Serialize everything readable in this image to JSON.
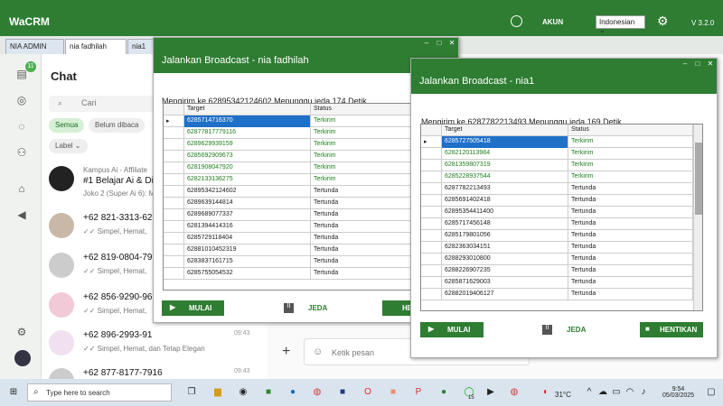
{
  "app": {
    "title": "WaCRM",
    "account_label": "AKUN",
    "language": "Indonesian",
    "version": "V 3.2.0"
  },
  "tabs": [
    "NIA ADMIN",
    "nia fadhilah",
    "nia1"
  ],
  "sidebar": {
    "badge": "11"
  },
  "chat": {
    "title": "Chat",
    "search_placeholder": "Cari",
    "filters": [
      "Semua",
      "Belum dibaca"
    ],
    "label_filter": "Label",
    "rows": [
      {
        "sub": "Kampus Ai - Affiliate",
        "name": "#1 Belajar Ai & Di",
        "msg": "Joko 2 (Super Ai 6): M",
        "time": ""
      },
      {
        "sub": "",
        "name": "+62 821-3313-62",
        "msg": "✓✓ Simpel, Hemat,",
        "time": ""
      },
      {
        "sub": "",
        "name": "+62 819-0804-79",
        "msg": "✓✓ Simpel, Hemat,",
        "time": ""
      },
      {
        "sub": "",
        "name": "+62 856-9290-96",
        "msg": "✓✓ Simpel, Hemat,",
        "time": ""
      },
      {
        "sub": "",
        "name": "+62 896-2993-91",
        "msg": "✓✓ Simpel, Hemat, dan Tetap Elegan",
        "time": "09:43"
      },
      {
        "sub": "",
        "name": "+62 877-8177-7916",
        "msg": "",
        "time": "09:43"
      }
    ]
  },
  "compose": {
    "placeholder": "Ketik pesan"
  },
  "broadcast_left": {
    "title": "Jalankan Broadcast - nia fadhilah",
    "info": "Mengirim ke 62895342124602  Menunggu jeda 174 Detik",
    "col_target": "Target",
    "col_status": "Status",
    "rows": [
      [
        "6285714716370",
        "Terkirim"
      ],
      [
        "62877817779116",
        "Terkirim"
      ],
      [
        "6289629939159",
        "Terkirim"
      ],
      [
        "6285692909673",
        "Terkirim"
      ],
      [
        "6281908047920",
        "Terkirim"
      ],
      [
        "6282133136275",
        "Terkirim"
      ],
      [
        "62895342124602",
        "Tertunda"
      ],
      [
        "6289639144814",
        "Tertunda"
      ],
      [
        "6289689077337",
        "Tertunda"
      ],
      [
        "6281394414316",
        "Tertunda"
      ],
      [
        "6285729118404",
        "Tertunda"
      ],
      [
        "62881010452319",
        "Tertunda"
      ],
      [
        "6283837161715",
        "Tertunda"
      ],
      [
        "6285755054532",
        "Tertunda"
      ]
    ],
    "btn_start": "MULAI",
    "btn_pause": "JEDA",
    "btn_stop": "HE"
  },
  "broadcast_right": {
    "title": "Jalankan Broadcast - nia1",
    "info": "Mengirim ke 6287782213493  Menunggu jeda 169 Detik",
    "col_target": "Target",
    "col_status": "Status",
    "rows": [
      [
        "6285727505418",
        "Terkirim"
      ],
      [
        "6282120113984",
        "Terkirim"
      ],
      [
        "6281359807319",
        "Terkirim"
      ],
      [
        "6285228937544",
        "Terkirim"
      ],
      [
        "6287782213493",
        "Tertunda"
      ],
      [
        "6285691402418",
        "Tertunda"
      ],
      [
        "62895354411400",
        "Tertunda"
      ],
      [
        "6285717456148",
        "Tertunda"
      ],
      [
        "6285179801056",
        "Tertunda"
      ],
      [
        "6282363034151",
        "Tertunda"
      ],
      [
        "6288293010800",
        "Tertunda"
      ],
      [
        "6288226907235",
        "Tertunda"
      ],
      [
        "6285871629003",
        "Tertunda"
      ],
      [
        "62882019406127",
        "Tertunda"
      ]
    ],
    "btn_start": "MULAI",
    "btn_pause": "JEDA",
    "btn_stop": "HENTIKAN"
  },
  "taskbar": {
    "search_placeholder": "Type here to search",
    "temp": "31°C",
    "time": "9:54",
    "date": "05/03/2025",
    "notif": "15"
  }
}
